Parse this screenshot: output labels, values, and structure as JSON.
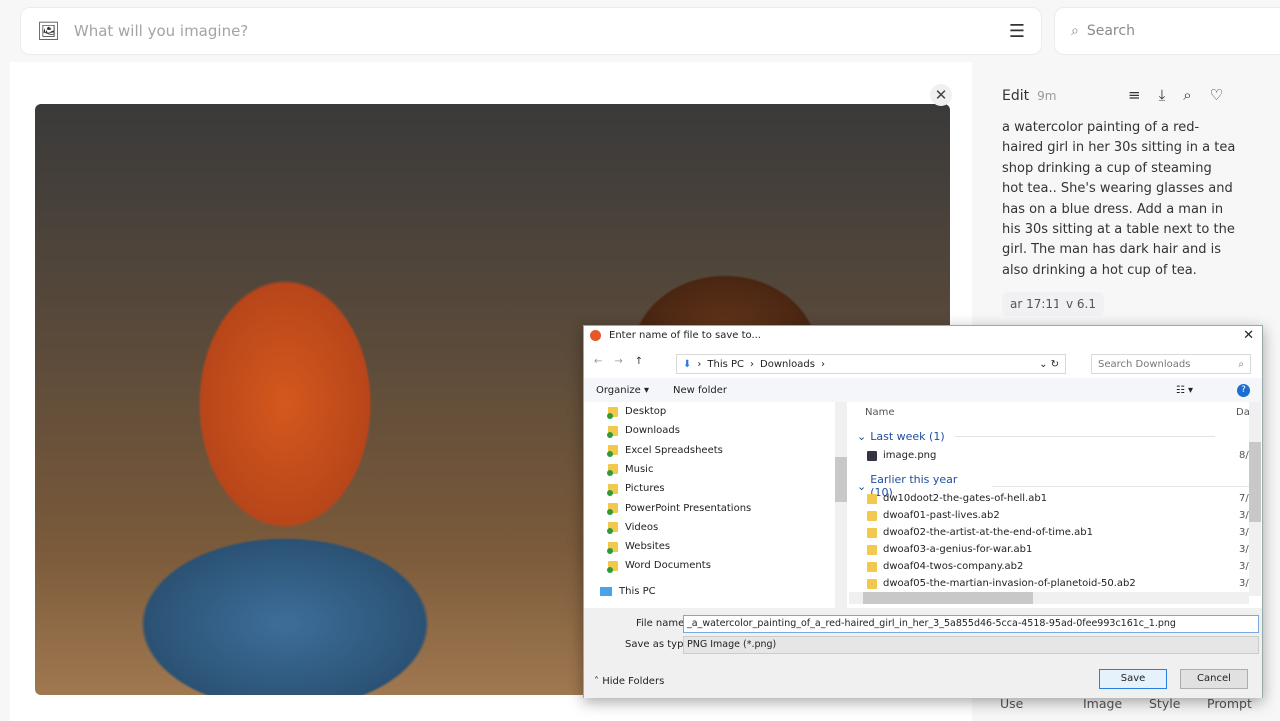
{
  "topbar": {
    "placeholder": "What will you imagine?",
    "search_placeholder": "Search"
  },
  "side": {
    "edit": "Edit",
    "age": "9m",
    "prompt": "a watercolor painting of a red-haired girl in her 30s sitting in a tea shop drinking a cup of steaming hot tea.. She's wearing glasses and has on a blue dress. Add a man in his 30s sitting at a table next to the girl. The man has dark hair and is also drinking a hot cup of tea.",
    "tags": [
      "ar 17:11",
      "v 6.1"
    ],
    "bottom": [
      "Use",
      "Image",
      "Style",
      "Prompt"
    ]
  },
  "dialog": {
    "title": "Enter name of file to save to...",
    "path": [
      "This PC",
      "Downloads"
    ],
    "search": "Search Downloads",
    "organize": "Organize ▾",
    "new_folder": "New folder",
    "nav": [
      "Desktop",
      "Downloads",
      "Excel Spreadsheets",
      "Music",
      "Pictures",
      "PowerPoint Presentations",
      "Videos",
      "Websites",
      "Word Documents"
    ],
    "this_pc": "This PC",
    "col_name": "Name",
    "col_date": "Da",
    "groups": [
      {
        "label": "Last week (1)",
        "files": [
          {
            "name": "image.png",
            "date": "8/"
          }
        ]
      },
      {
        "label": "Earlier this year (10)",
        "files": [
          {
            "name": "dw10doot2-the-gates-of-hell.ab1",
            "date": "7/"
          },
          {
            "name": "dwoaf01-past-lives.ab2",
            "date": "3/"
          },
          {
            "name": "dwoaf02-the-artist-at-the-end-of-time.ab1",
            "date": "3/"
          },
          {
            "name": "dwoaf03-a-genius-for-war.ab1",
            "date": "3/"
          },
          {
            "name": "dwoaf04-twos-company.ab2",
            "date": "3/"
          },
          {
            "name": "dwoaf05-the-martian-invasion-of-planetoid-50.ab2",
            "date": "3/"
          }
        ]
      }
    ],
    "file_name_label": "File name:",
    "file_name": "_a_watercolor_painting_of_a_red-haired_girl_in_her_3_5a855d46-5cca-4518-95ad-0fee993c161c_1.png",
    "type_label": "Save as type:",
    "type": "PNG Image (*.png)",
    "hide": "Hide Folders",
    "save": "Save",
    "cancel": "Cancel"
  }
}
